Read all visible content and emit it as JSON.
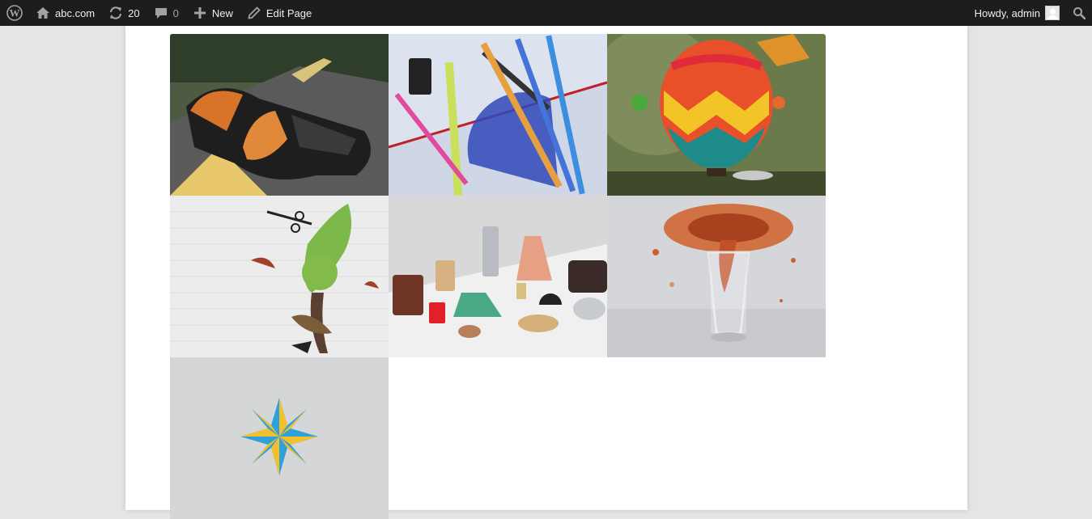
{
  "adminbar": {
    "site_name": "abc.com",
    "updates_count": "20",
    "comments_count": "0",
    "new_label": "New",
    "edit_label": "Edit Page",
    "howdy_label": "Howdy, admin"
  },
  "colors": {
    "adminbar_bg": "#1d1d1d",
    "page_bg": "#ffffff",
    "outer_bg": "#e5e5e5"
  },
  "gallery": {
    "images": [
      {
        "subject": "shoe-on-road"
      },
      {
        "subject": "school-stationery"
      },
      {
        "subject": "hot-air-balloon"
      },
      {
        "subject": "paint-splash-tree"
      },
      {
        "subject": "wooden-objects"
      },
      {
        "subject": "splashing-glass"
      },
      {
        "subject": "origami-star"
      }
    ]
  }
}
